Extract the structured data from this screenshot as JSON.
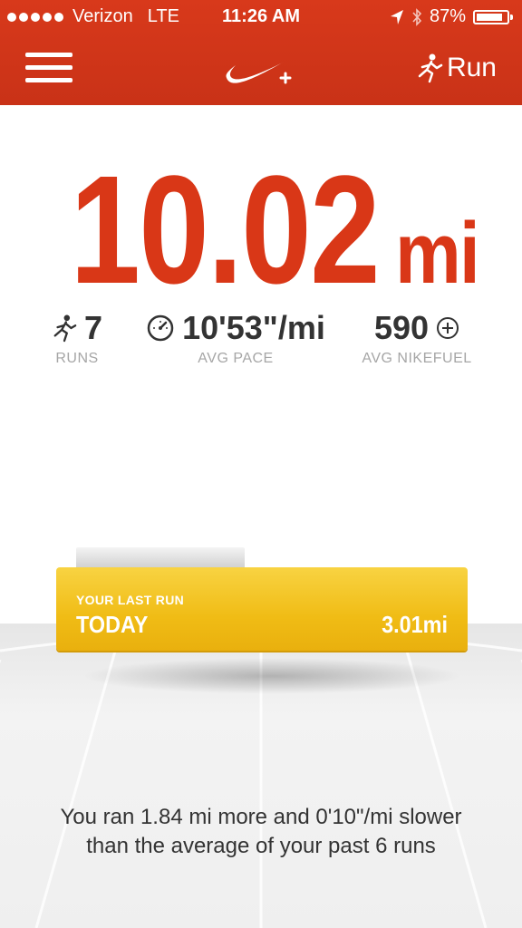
{
  "status_bar": {
    "carrier": "Verizon",
    "network": "LTE",
    "time": "11:26 AM",
    "battery": "87%",
    "battery_level": 0.87
  },
  "nav": {
    "menu_icon": "hamburger-menu-icon",
    "logo_icon": "nike-plus-logo",
    "run_label": "Run",
    "run_icon": "runner-icon"
  },
  "summary": {
    "total_value": "10.02",
    "total_unit": "mi",
    "runs_value": "7",
    "runs_label": "RUNS",
    "pace_value": "10'53\"/mi",
    "pace_label": "AVG PACE",
    "fuel_value": "590",
    "fuel_label": "AVG NIKEFUEL"
  },
  "last_run": {
    "label": "YOUR LAST RUN",
    "day": "TODAY",
    "distance": "3.01mi"
  },
  "message": "You ran 1.84 mi more and 0'10\"/mi slower than the average of your past 6 runs",
  "colors": {
    "brand_red": "#d8391b",
    "accent_yellow": "#f0bc15"
  }
}
